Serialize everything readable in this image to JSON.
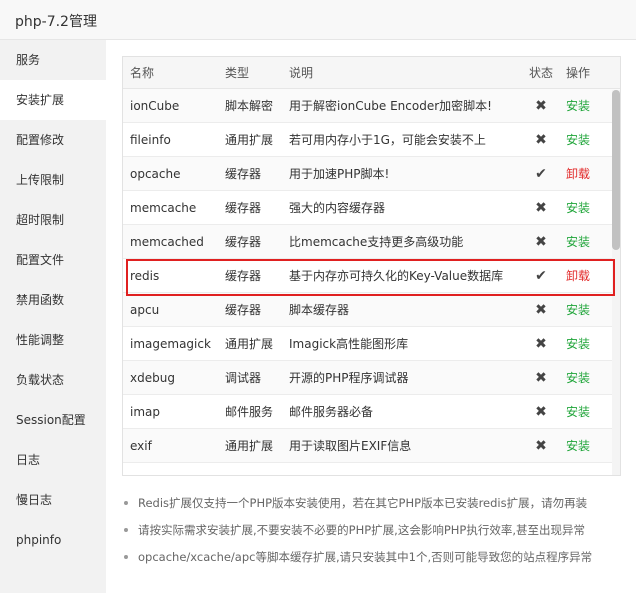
{
  "window": {
    "title": "php-7.2管理"
  },
  "sidebar": {
    "items": [
      {
        "label": "服务"
      },
      {
        "label": "安装扩展"
      },
      {
        "label": "配置修改"
      },
      {
        "label": "上传限制"
      },
      {
        "label": "超时限制"
      },
      {
        "label": "配置文件"
      },
      {
        "label": "禁用函数"
      },
      {
        "label": "性能调整"
      },
      {
        "label": "负载状态"
      },
      {
        "label": "Session配置"
      },
      {
        "label": "日志"
      },
      {
        "label": "慢日志"
      },
      {
        "label": "phpinfo"
      }
    ],
    "active_index": 1
  },
  "table": {
    "headers": {
      "name": "名称",
      "type": "类型",
      "desc": "说明",
      "status": "状态",
      "action": "操作"
    },
    "rows": [
      {
        "name": "ionCube",
        "type": "脚本解密",
        "desc": "用于解密ionCube Encoder加密脚本!",
        "status": "✖",
        "action": "安装",
        "installed": false
      },
      {
        "name": "fileinfo",
        "type": "通用扩展",
        "desc": "若可用内存小于1G，可能会安装不上",
        "status": "✖",
        "action": "安装",
        "installed": false
      },
      {
        "name": "opcache",
        "type": "缓存器",
        "desc": "用于加速PHP脚本!",
        "status": "✔",
        "action": "卸载",
        "installed": true
      },
      {
        "name": "memcache",
        "type": "缓存器",
        "desc": "强大的内容缓存器",
        "status": "✖",
        "action": "安装",
        "installed": false
      },
      {
        "name": "memcached",
        "type": "缓存器",
        "desc": "比memcache支持更多高级功能",
        "status": "✖",
        "action": "安装",
        "installed": false
      },
      {
        "name": "redis",
        "type": "缓存器",
        "desc": "基于内存亦可持久化的Key-Value数据库",
        "status": "✔",
        "action": "卸载",
        "installed": true
      },
      {
        "name": "apcu",
        "type": "缓存器",
        "desc": "脚本缓存器",
        "status": "✖",
        "action": "安装",
        "installed": false
      },
      {
        "name": "imagemagick",
        "type": "通用扩展",
        "desc": "Imagick高性能图形库",
        "status": "✖",
        "action": "安装",
        "installed": false
      },
      {
        "name": "xdebug",
        "type": "调试器",
        "desc": "开源的PHP程序调试器",
        "status": "✖",
        "action": "安装",
        "installed": false
      },
      {
        "name": "imap",
        "type": "邮件服务",
        "desc": "邮件服务器必备",
        "status": "✖",
        "action": "安装",
        "installed": false
      },
      {
        "name": "exif",
        "type": "通用扩展",
        "desc": "用于读取图片EXIF信息",
        "status": "✖",
        "action": "安装",
        "installed": false
      }
    ]
  },
  "notes": [
    "Redis扩展仅支持一个PHP版本安装使用，若在其它PHP版本已安装redis扩展，请勿再装",
    "请按实际需求安装扩展,不要安装不必要的PHP扩展,这会影响PHP执行效率,甚至出现异常",
    "opcache/xcache/apc等脚本缓存扩展,请只安装其中1个,否则可能导致您的站点程序异常"
  ],
  "colors": {
    "install": "#20a53a",
    "uninstall": "#e22a2a",
    "highlight": "#e02020"
  }
}
